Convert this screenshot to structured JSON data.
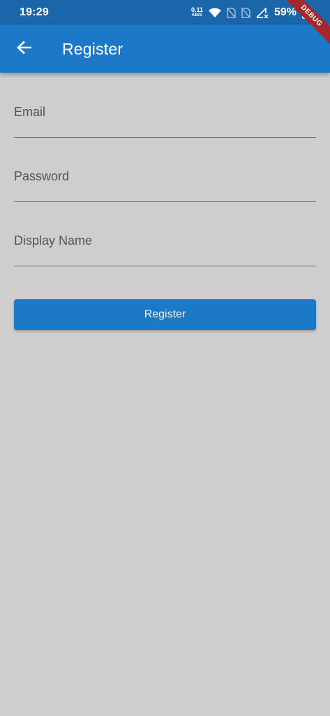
{
  "status_bar": {
    "time": "19:29",
    "net_speed_value": "0.11",
    "net_speed_unit": "KB/S",
    "battery_percent": "59%",
    "icons": [
      "wifi-icon",
      "sim-no-signal-icon",
      "sim-no-signal-icon",
      "cellular-no-signal-icon",
      "battery-icon"
    ]
  },
  "app_bar": {
    "title": "Register",
    "back_icon": "arrow-back-icon",
    "debug_banner": "DEBUG"
  },
  "form": {
    "email_label": "Email",
    "password_label": "Password",
    "display_name_label": "Display Name",
    "submit_label": "Register"
  },
  "colors": {
    "status_bar": "#1b66ab",
    "app_bar": "#1b79c7",
    "background": "#cecece",
    "button": "#1b79c7",
    "debug_banner": "#a3282c",
    "field_label": "#555555",
    "underline": "#6e6e6e"
  }
}
